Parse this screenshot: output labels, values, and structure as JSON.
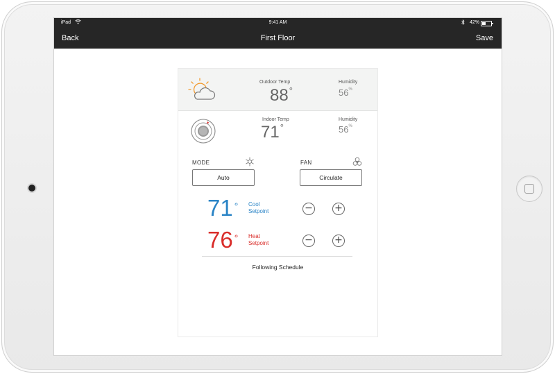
{
  "statusbar": {
    "device": "iPad",
    "time": "9:41 AM",
    "battery": "42%",
    "battery_level": 0.42
  },
  "navbar": {
    "back_label": "Back",
    "title": "First Floor",
    "save_label": "Save"
  },
  "outdoor": {
    "label": "Outdoor Temp",
    "temp": "88",
    "deg": "°",
    "humidity_label": "Humidity",
    "humidity_value": "56",
    "humidity_unit": "%",
    "icon": "sun-cloud-icon"
  },
  "indoor": {
    "label": "Indoor Temp",
    "temp": "71",
    "deg": "°",
    "humidity_label": "Humidity",
    "humidity_value": "56",
    "humidity_unit": "%",
    "icon": "thermostat-icon"
  },
  "mode": {
    "label": "MODE",
    "value": "Auto",
    "icon": "sun-snowflake-icon"
  },
  "fan": {
    "label": "FAN",
    "value": "Circulate",
    "icon": "fan-icon"
  },
  "cool": {
    "value": "71",
    "deg": "°",
    "label_line1": "Cool",
    "label_line2": "Setpoint",
    "color": "#2a84c6",
    "minus": "−",
    "plus": "+"
  },
  "heat": {
    "value": "76",
    "deg": "°",
    "label_line1": "Heat",
    "label_line2": "Setpoint",
    "color": "#d92d2a",
    "minus": "−",
    "plus": "+"
  },
  "schedule": {
    "text": "Following Schedule"
  },
  "colors": {
    "bar": "#262626",
    "sun": "#f29a2e"
  }
}
